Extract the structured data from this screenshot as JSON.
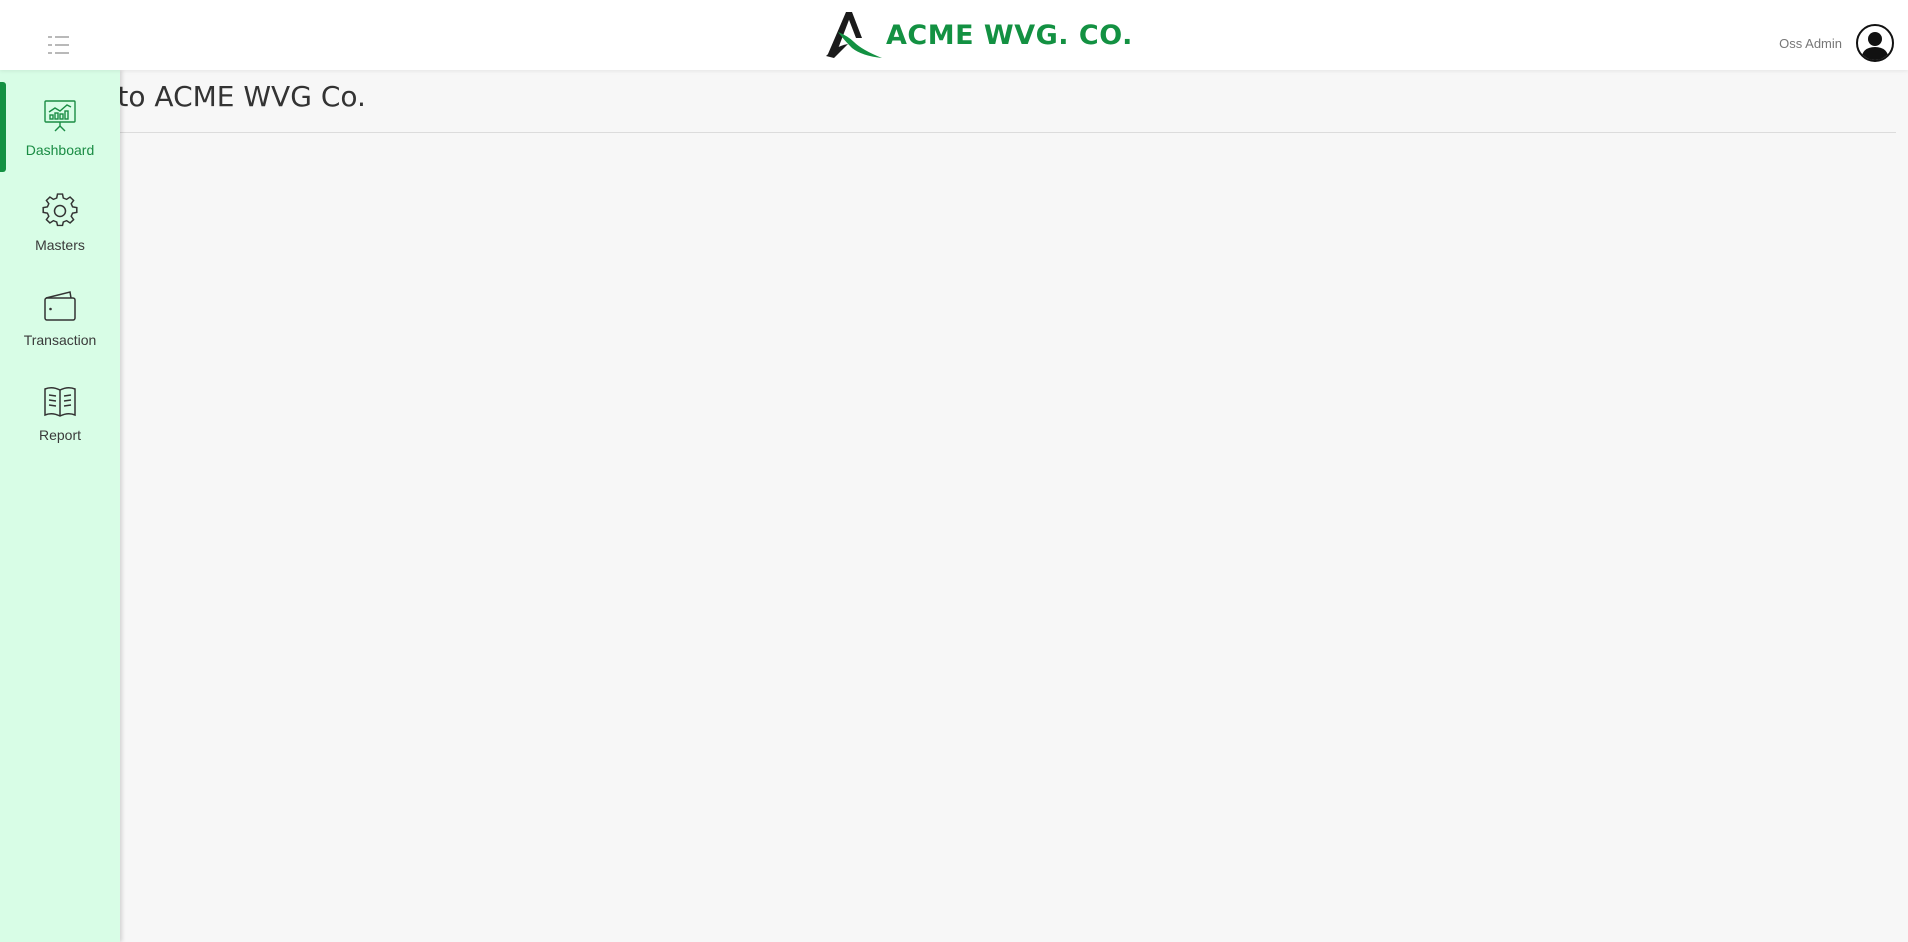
{
  "header": {
    "brand_text": "ACME WVG. CO.",
    "brand_color": "#139142",
    "menu_toggle_icon": "menu-list-icon",
    "user_name": "Oss Admin",
    "avatar_icon": "user-avatar-icon"
  },
  "main": {
    "title": "me to ACME WVG Co."
  },
  "sidebar": {
    "background": "#d8fde6",
    "accent": "#139142",
    "items": [
      {
        "label": "Dashboard",
        "icon": "dashboard-presentation-icon",
        "active": true
      },
      {
        "label": "Masters",
        "icon": "gear-icon",
        "active": false
      },
      {
        "label": "Transaction",
        "icon": "wallet-icon",
        "active": false
      },
      {
        "label": "Report",
        "icon": "open-book-icon",
        "active": false
      }
    ]
  }
}
